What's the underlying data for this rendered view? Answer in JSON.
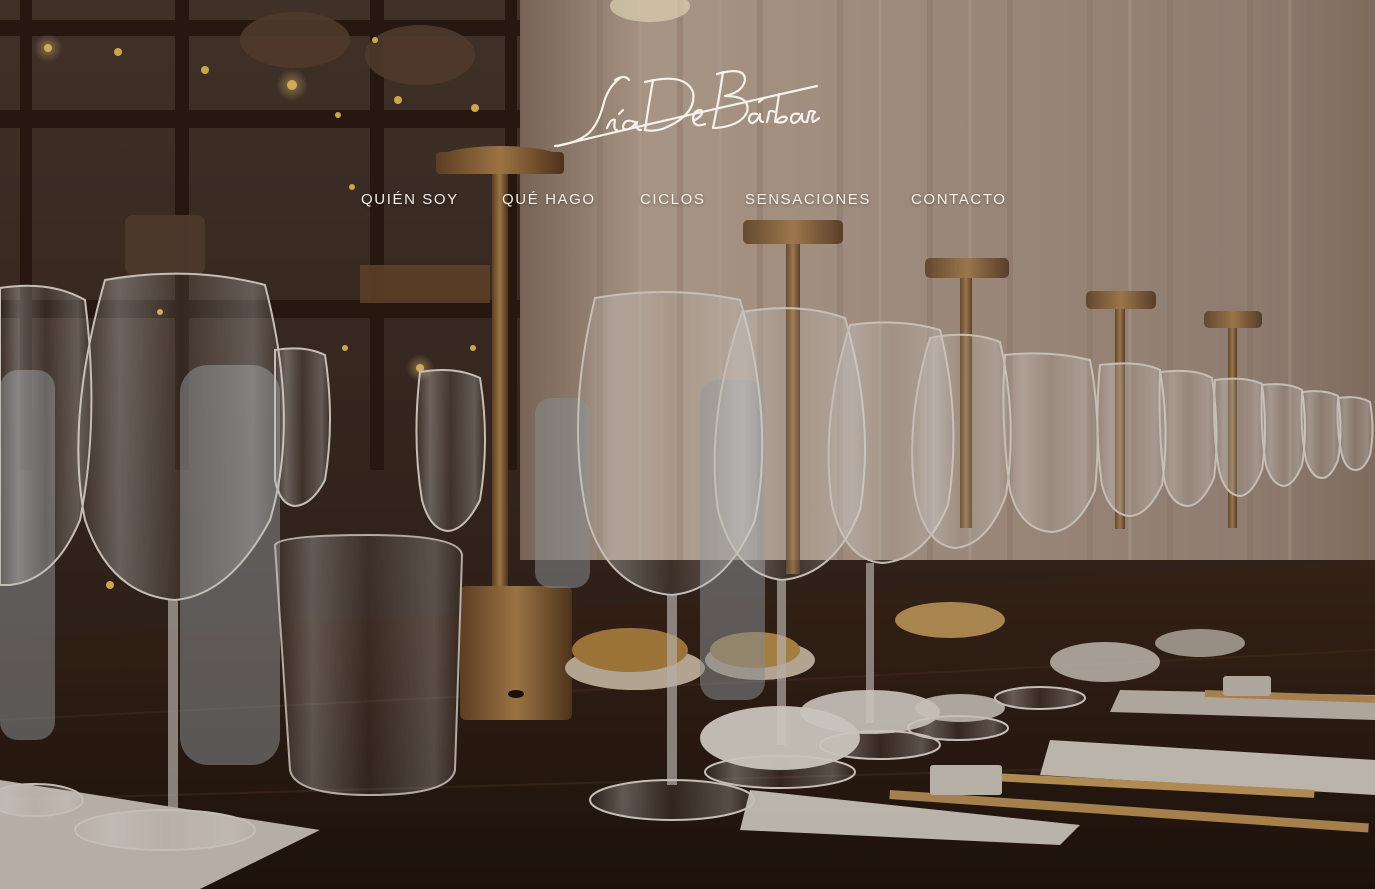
{
  "site": {
    "logo_text": "Lía De Bárbara"
  },
  "nav": {
    "items": [
      {
        "label": "QUIÉN SOY"
      },
      {
        "label": "QUÉ HAGO"
      },
      {
        "label": "CICLOS"
      },
      {
        "label": "SENSACIONES"
      },
      {
        "label": "CONTACTO"
      }
    ]
  },
  "hero": {
    "scene": "wine-tasting-table"
  },
  "colors": {
    "nav_text": "#f4efe9",
    "logo": "#f6f1ea",
    "curtain": "#c9b6a4",
    "wood": "#3a2518",
    "brass": "#a7743f"
  }
}
